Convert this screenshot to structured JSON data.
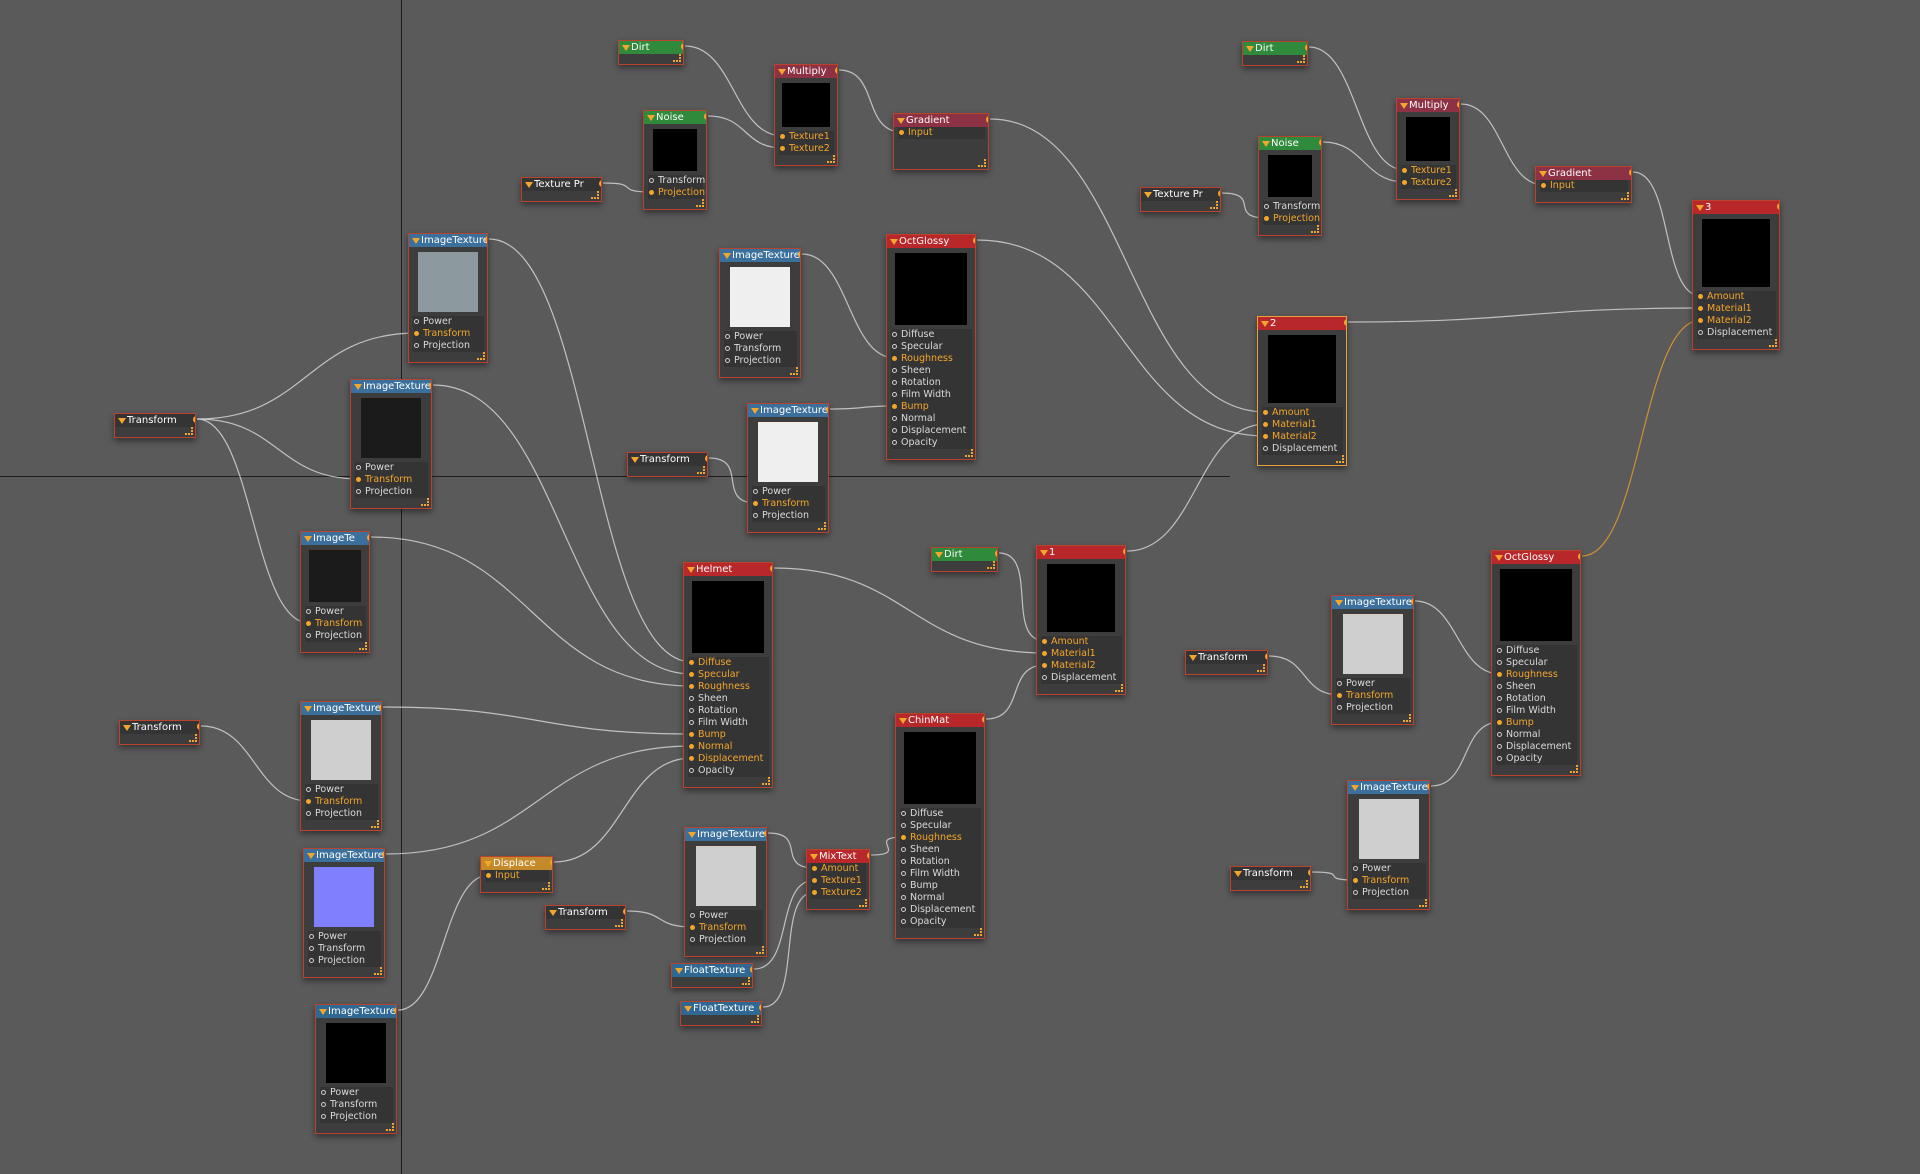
{
  "colors": {
    "background": "#5a5a5a",
    "wire": "#d3d3d3",
    "wire_active": "#e39a2a",
    "pin_active": "#f3a62b",
    "header_image_texture": "#3b6f9c",
    "header_procedural": "#2f8a3b",
    "header_gradient_multiply": "#8d3145",
    "header_material": "#b8272a",
    "header_transform": "#343434"
  },
  "nodes": [
    {
      "title": "Dirt",
      "ports": []
    },
    {
      "title": "Multiply",
      "ports": [
        {
          "label": "Texture1",
          "active": true
        },
        {
          "label": "Texture2",
          "active": true
        }
      ]
    },
    {
      "title": "Noise",
      "ports": [
        {
          "label": "Transform",
          "active": false
        },
        {
          "label": "Projection",
          "active": true
        }
      ]
    },
    {
      "title": "Gradient",
      "ports": [
        {
          "label": "Input",
          "active": true
        }
      ]
    },
    {
      "title": "Texture Pr",
      "ports": []
    },
    {
      "title": "Dirt",
      "ports": []
    },
    {
      "title": "Noise",
      "ports": [
        {
          "label": "Transform",
          "active": false
        },
        {
          "label": "Projection",
          "active": true
        }
      ]
    },
    {
      "title": "Multiply",
      "ports": [
        {
          "label": "Texture1",
          "active": true
        },
        {
          "label": "Texture2",
          "active": true
        }
      ]
    },
    {
      "title": "Gradient",
      "ports": [
        {
          "label": "Input",
          "active": true
        }
      ]
    },
    {
      "title": "Texture Pr",
      "ports": []
    },
    {
      "title": "3",
      "ports": [
        {
          "label": "Amount",
          "active": true
        },
        {
          "label": "Material1",
          "active": true
        },
        {
          "label": "Material2",
          "active": true
        },
        {
          "label": "Displacement",
          "active": false
        }
      ]
    },
    {
      "title": "2",
      "ports": [
        {
          "label": "Amount",
          "active": true
        },
        {
          "label": "Material1",
          "active": true
        },
        {
          "label": "Material2",
          "active": true
        },
        {
          "label": "Displacement",
          "active": false
        }
      ]
    },
    {
      "title": "ImageTexture",
      "ports": [
        {
          "label": "Power",
          "active": false
        },
        {
          "label": "Transform",
          "active": true
        },
        {
          "label": "Projection",
          "active": false
        }
      ]
    },
    {
      "title": "ImageTexture",
      "ports": [
        {
          "label": "Power",
          "active": false
        },
        {
          "label": "Transform",
          "active": true
        },
        {
          "label": "Projection",
          "active": false
        }
      ]
    },
    {
      "title": "Transform",
      "ports": []
    },
    {
      "title": "ImageTe",
      "ports": [
        {
          "label": "Power",
          "active": false
        },
        {
          "label": "Transform",
          "active": true
        },
        {
          "label": "Projection",
          "active": false
        }
      ]
    },
    {
      "title": "Transform",
      "ports": []
    },
    {
      "title": "ImageTexture",
      "ports": [
        {
          "label": "Power",
          "active": false
        },
        {
          "label": "Transform",
          "active": true
        },
        {
          "label": "Projection",
          "active": false
        }
      ]
    },
    {
      "title": "ImageTexture",
      "ports": [
        {
          "label": "Power",
          "active": false
        },
        {
          "label": "Transform",
          "active": false
        },
        {
          "label": "Projection",
          "active": false
        }
      ]
    },
    {
      "title": "ImageTexture",
      "ports": [
        {
          "label": "Power",
          "active": false
        },
        {
          "label": "Transform",
          "active": false
        },
        {
          "label": "Projection",
          "active": false
        }
      ]
    },
    {
      "title": "Displace",
      "ports": [
        {
          "label": "Input",
          "active": true
        }
      ]
    },
    {
      "title": "ImageTexture",
      "ports": [
        {
          "label": "Power",
          "active": false
        },
        {
          "label": "Transform",
          "active": false
        },
        {
          "label": "Projection",
          "active": false
        }
      ]
    },
    {
      "title": "Transform",
      "ports": []
    },
    {
      "title": "ImageTexture",
      "ports": [
        {
          "label": "Power",
          "active": false
        },
        {
          "label": "Transform",
          "active": true
        },
        {
          "label": "Projection",
          "active": false
        }
      ]
    },
    {
      "title": "OctGlossy",
      "ports": [
        {
          "label": "Diffuse",
          "active": false
        },
        {
          "label": "Specular",
          "active": false
        },
        {
          "label": "Roughness",
          "active": true
        },
        {
          "label": "Sheen",
          "active": false
        },
        {
          "label": "Rotation",
          "active": false
        },
        {
          "label": "Film Width",
          "active": false
        },
        {
          "label": "Bump",
          "active": true
        },
        {
          "label": "Normal",
          "active": false
        },
        {
          "label": "Displacement",
          "active": false
        },
        {
          "label": "Opacity",
          "active": false
        }
      ]
    },
    {
      "title": "Helmet",
      "ports": [
        {
          "label": "Diffuse",
          "active": true
        },
        {
          "label": "Specular",
          "active": true
        },
        {
          "label": "Roughness",
          "active": true
        },
        {
          "label": "Sheen",
          "active": false
        },
        {
          "label": "Rotation",
          "active": false
        },
        {
          "label": "Film Width",
          "active": false
        },
        {
          "label": "Bump",
          "active": true
        },
        {
          "label": "Normal",
          "active": true
        },
        {
          "label": "Displacement",
          "active": true
        },
        {
          "label": "Opacity",
          "active": false
        }
      ]
    },
    {
      "title": "Dirt",
      "ports": []
    },
    {
      "title": "1",
      "ports": [
        {
          "label": "Amount",
          "active": true
        },
        {
          "label": "Material1",
          "active": true
        },
        {
          "label": "Material2",
          "active": true
        },
        {
          "label": "Displacement",
          "active": false
        }
      ]
    },
    {
      "title": "ChinMat",
      "ports": [
        {
          "label": "Diffuse",
          "active": false
        },
        {
          "label": "Specular",
          "active": false
        },
        {
          "label": "Roughness",
          "active": true
        },
        {
          "label": "Sheen",
          "active": false
        },
        {
          "label": "Rotation",
          "active": false
        },
        {
          "label": "Film Width",
          "active": false
        },
        {
          "label": "Bump",
          "active": false
        },
        {
          "label": "Normal",
          "active": false
        },
        {
          "label": "Displacement",
          "active": false
        },
        {
          "label": "Opacity",
          "active": false
        }
      ]
    },
    {
      "title": "ImageTexture",
      "ports": [
        {
          "label": "Power",
          "active": false
        },
        {
          "label": "Transform",
          "active": true
        },
        {
          "label": "Projection",
          "active": false
        }
      ]
    },
    {
      "title": "Transform",
      "ports": []
    },
    {
      "title": "MixText",
      "ports": [
        {
          "label": "Amount",
          "active": true
        },
        {
          "label": "Texture1",
          "active": true
        },
        {
          "label": "Texture2",
          "active": true
        }
      ]
    },
    {
      "title": "FloatTexture",
      "ports": []
    },
    {
      "title": "FloatTexture",
      "ports": []
    },
    {
      "title": "Transform",
      "ports": []
    },
    {
      "title": "ImageTexture",
      "ports": [
        {
          "label": "Power",
          "active": false
        },
        {
          "label": "Transform",
          "active": true
        },
        {
          "label": "Projection",
          "active": false
        }
      ]
    },
    {
      "title": "OctGlossy",
      "ports": [
        {
          "label": "Diffuse",
          "active": false
        },
        {
          "label": "Specular",
          "active": false
        },
        {
          "label": "Roughness",
          "active": true
        },
        {
          "label": "Sheen",
          "active": false
        },
        {
          "label": "Rotation",
          "active": false
        },
        {
          "label": "Film Width",
          "active": false
        },
        {
          "label": "Bump",
          "active": true
        },
        {
          "label": "Normal",
          "active": false
        },
        {
          "label": "Displacement",
          "active": false
        },
        {
          "label": "Opacity",
          "active": false
        }
      ]
    },
    {
      "title": "ImageTexture",
      "ports": [
        {
          "label": "Power",
          "active": false
        },
        {
          "label": "Transform",
          "active": true
        },
        {
          "label": "Projection",
          "active": false
        }
      ]
    },
    {
      "title": "Transform",
      "ports": []
    }
  ]
}
